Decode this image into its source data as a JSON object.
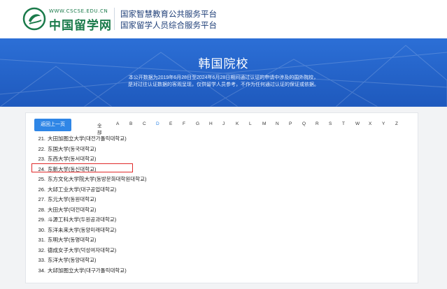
{
  "header": {
    "logo_url_text": "WWW.CSCSE.EDU.CN",
    "logo_text": "中国留学网",
    "platform_line_1": "国家智慧教育公共服务平台",
    "platform_line_2": "国家留学人员综合服务平台"
  },
  "banner": {
    "title": "韩国院校",
    "notice_line_1": "本公开数据为2019年6月28日至2024年6月28日期间通过认证的申请中涉及的国外院校，",
    "notice_line_2": "是对过往认证数据的客观呈现，仅供留学人员参考，不作为任何通过认证的保证或依据。"
  },
  "toolbar": {
    "back_label": "返回上一页"
  },
  "alphabet": {
    "items": [
      "全部",
      "A",
      "B",
      "C",
      "D",
      "E",
      "F",
      "G",
      "H",
      "J",
      "K",
      "L",
      "M",
      "N",
      "P",
      "Q",
      "R",
      "S",
      "T",
      "W",
      "X",
      "Y",
      "Z"
    ],
    "active": "D"
  },
  "schools": [
    {
      "num": "21.",
      "name": "大田加图立大学(대전가톨릭대학교)"
    },
    {
      "num": "22.",
      "name": "东国大学(동국대학교)"
    },
    {
      "num": "23.",
      "name": "东西大学(동서대학교)"
    },
    {
      "num": "24.",
      "name": "东新大学(동신대학교)"
    },
    {
      "num": "25.",
      "name": "东方文化大学院大学(동방문화대학원대학교)"
    },
    {
      "num": "26.",
      "name": "大邱工业大学(대구공업대학교)"
    },
    {
      "num": "27.",
      "name": "东元大学(동원대학교)"
    },
    {
      "num": "28.",
      "name": "大田大学(대전대학교)"
    },
    {
      "num": "29.",
      "name": "斗源工科大学(두원공과대학교)"
    },
    {
      "num": "30.",
      "name": "东洋未来大学(동양미래대학교)"
    },
    {
      "num": "31.",
      "name": "东明大学(동명대학교)"
    },
    {
      "num": "32.",
      "name": "德成女子大学(덕성여자대학교)"
    },
    {
      "num": "33.",
      "name": "东洋大学(동양대학교)"
    },
    {
      "num": "34.",
      "name": "大邱加图立大学(대구가톨릭대학교)"
    }
  ],
  "highlighted_item": "24.",
  "colors": {
    "brand_green": "#1a7a4a",
    "banner_blue": "#2c6fd6",
    "button_blue": "#2f86e6",
    "highlight_red": "#e02a2a"
  }
}
